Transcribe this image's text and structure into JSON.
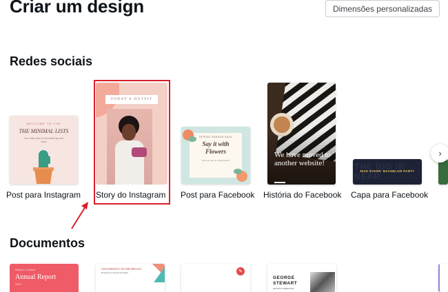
{
  "header": {
    "title": "Criar um design",
    "custom_dimensions_label": "Dimensões personalizadas"
  },
  "sections": {
    "social": {
      "title": "Redes sociais",
      "cards": [
        {
          "label": "Post para Instagram"
        },
        {
          "label": "Story do Instagram"
        },
        {
          "label": "Post para Facebook"
        },
        {
          "label": "História do Facebook"
        },
        {
          "label": "Capa para Facebook"
        }
      ]
    },
    "documents": {
      "title": "Documentos"
    }
  },
  "thumbnails": {
    "instagram_post": {
      "header": "WELCOME TO THE",
      "title": "THE MINIMAL LISTS",
      "subtitle": "Your daily dose of minimalist tips and ideas"
    },
    "instagram_story": {
      "title": "TODAY'S OUTFIT"
    },
    "facebook_post": {
      "small": "SPRING SEASON SALE",
      "title_line1": "Say it with",
      "title_line2": "Flowers",
      "caption": "Visit our shop for fresh blooms"
    },
    "facebook_story": {
      "text": "We have moved to another website!"
    },
    "facebook_cover": {
      "bg_text": "THE BIG IN NEAR",
      "text": "NICK EVANS' BACHELOR PARTY"
    },
    "annual_report": {
      "small": "Fiscal & Co Report",
      "title": "Annual Report",
      "year": "2019"
    },
    "university": {
      "title": "UNIVERSITY OF MICHIGAN",
      "lines": "Research proposal submitted"
    },
    "resume": {
      "name_line1": "GEORGE",
      "name_line2": "STEWART",
      "role": "ARTISTIC DIRECTOR"
    }
  },
  "navigation": {
    "next_icon": "chevron-right-icon",
    "next_glyph": "›"
  },
  "colors": {
    "highlight": "#d81e2a",
    "text": "#0e1318"
  }
}
